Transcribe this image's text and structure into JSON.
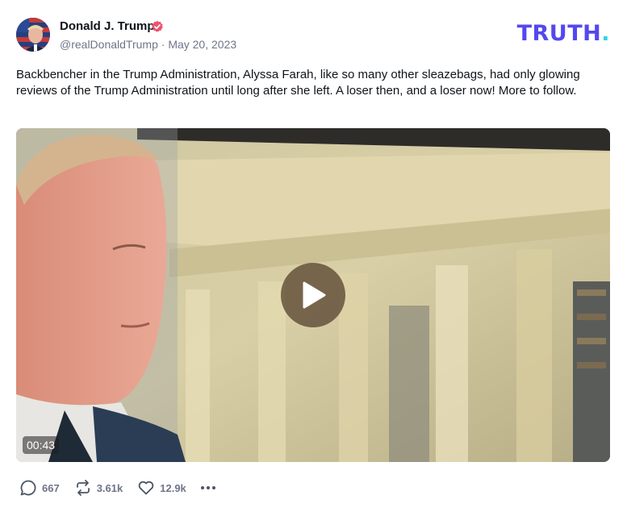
{
  "author": {
    "name": "Donald J. Trump",
    "handle": "@realDonaldTrump",
    "separator": "·",
    "date": "May 20, 2023"
  },
  "brand": {
    "logo_text": "TRUTH",
    "logo_dot": ".",
    "logo_color": "#5448ee",
    "dot_color": "#2fd5ea"
  },
  "post": {
    "text": "Backbencher in the Trump Administration, Alyssa Farah, like so many other sleazebags, had only glowing reviews of the Trump Administration until long after she left. A loser then, and a loser now! More to follow."
  },
  "video": {
    "duration": "00:43",
    "play_icon": "play-icon"
  },
  "actions": {
    "replies": "667",
    "retruths": "3.61k",
    "likes": "12.9k",
    "reply_icon": "comment-icon",
    "retruth_icon": "retruth-icon",
    "like_icon": "heart-icon",
    "more_icon": "more-icon"
  },
  "colors": {
    "verified": "#e8546f",
    "muted_text": "#707489"
  }
}
